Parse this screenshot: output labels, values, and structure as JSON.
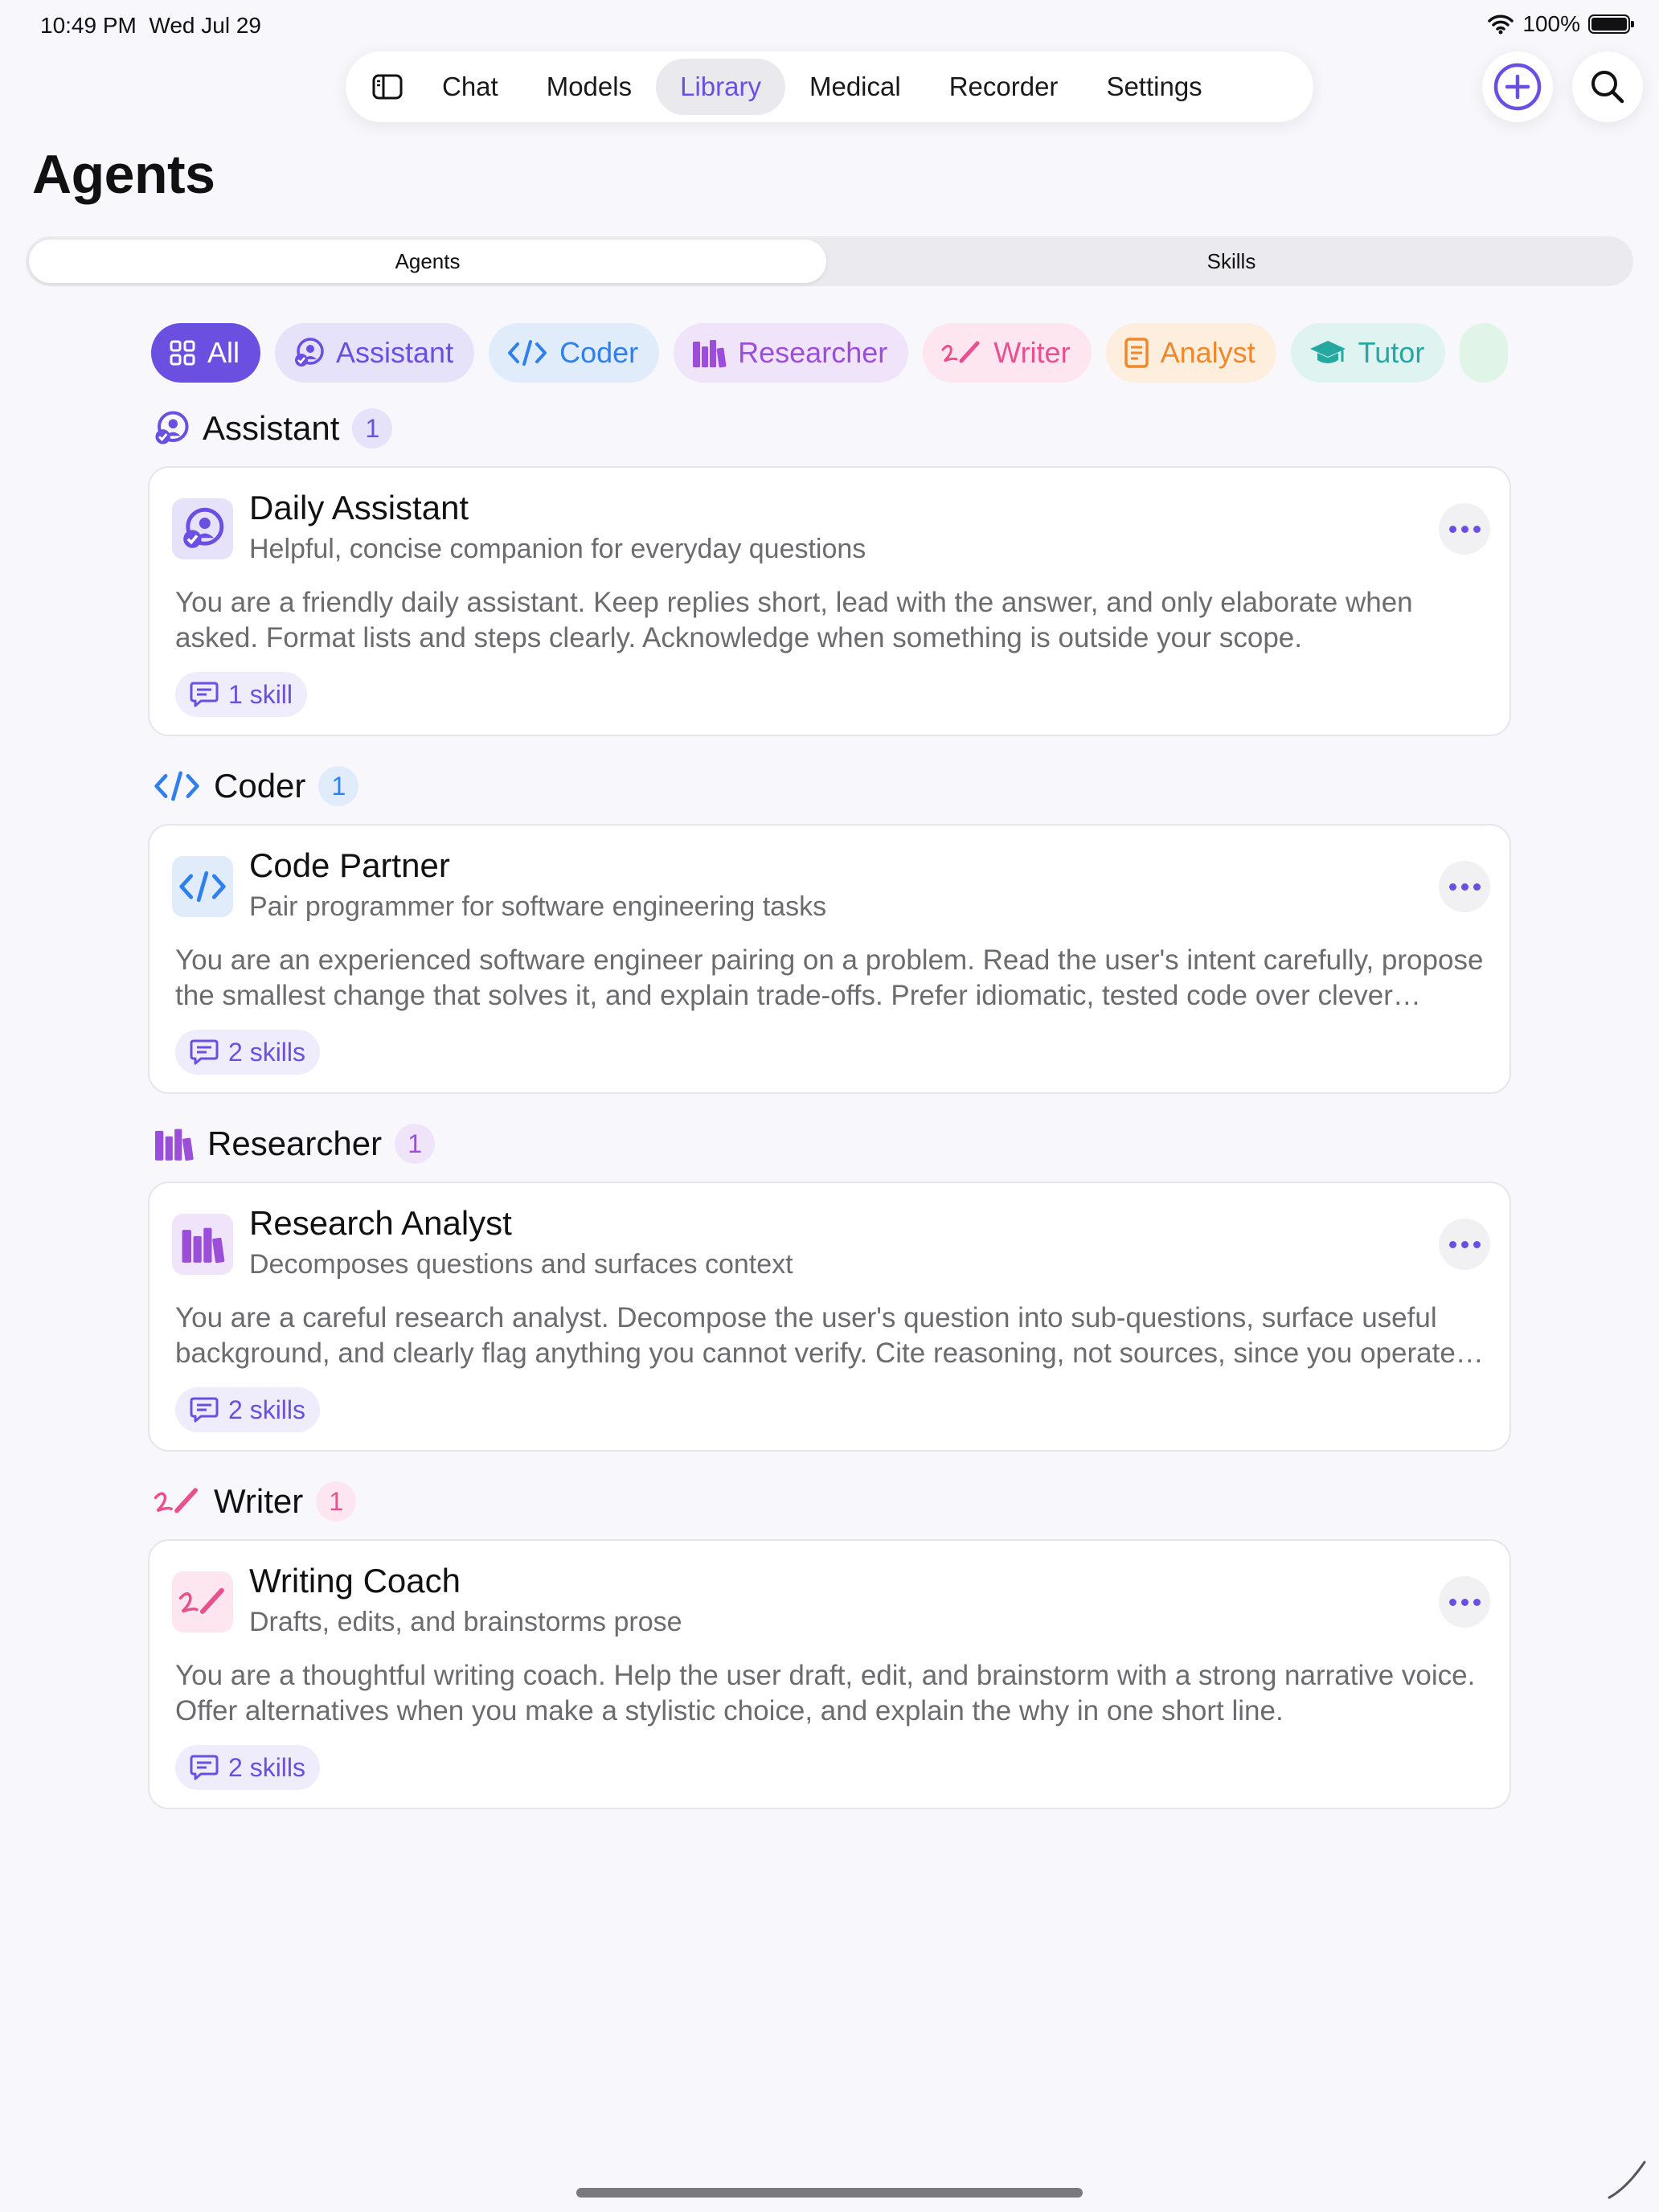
{
  "status": {
    "time": "10:49 PM",
    "date": "Wed Jul 29",
    "battery": "100%",
    "battery_level": 1.0
  },
  "nav": {
    "tabs": [
      {
        "label": "Chat",
        "active": false
      },
      {
        "label": "Models",
        "active": false
      },
      {
        "label": "Library",
        "active": true
      },
      {
        "label": "Medical",
        "active": false
      },
      {
        "label": "Recorder",
        "active": false
      },
      {
        "label": "Settings",
        "active": false
      }
    ],
    "sidebar_icon": "sidebar-toggle-icon",
    "add_icon": "plus-circle-icon",
    "search_icon": "search-icon"
  },
  "page": {
    "title": "Agents"
  },
  "segments": [
    {
      "label": "Agents",
      "active": true
    },
    {
      "label": "Skills",
      "active": false
    }
  ],
  "filters": [
    {
      "label": "All",
      "icon": "grid-icon",
      "active": true,
      "color": "#6b4fe0",
      "bg": "#6b4fe0"
    },
    {
      "label": "Assistant",
      "icon": "assistant-icon",
      "active": false,
      "color": "#6b4fe0",
      "bg": "#e6e2fa"
    },
    {
      "label": "Coder",
      "icon": "code-icon",
      "active": false,
      "color": "#2f80ed",
      "bg": "#e1ecfb"
    },
    {
      "label": "Researcher",
      "icon": "books-icon",
      "active": false,
      "color": "#9b4fd8",
      "bg": "#efe4fa"
    },
    {
      "label": "Writer",
      "icon": "pen-icon",
      "active": false,
      "color": "#e8508f",
      "bg": "#fde6ef"
    },
    {
      "label": "Analyst",
      "icon": "document-icon",
      "active": false,
      "color": "#f0882a",
      "bg": "#fdeede"
    },
    {
      "label": "Tutor",
      "icon": "graduation-cap-icon",
      "active": false,
      "color": "#24a8a0",
      "bg": "#dff3f1"
    }
  ],
  "sections": [
    {
      "name": "Assistant",
      "count": "1",
      "icon": "assistant-icon",
      "color": "#6b4fe0",
      "count_bg": "#e6e2fa",
      "agent": {
        "title": "Daily Assistant",
        "subtitle": "Helpful, concise companion for everyday questions",
        "body": "You are a friendly daily assistant. Keep replies short, lead with the answer, and only elaborate when asked. Format lists and steps clearly. Acknowledge when something is outside your scope.",
        "skills": "1 skill"
      }
    },
    {
      "name": "Coder",
      "count": "1",
      "icon": "code-icon",
      "color": "#2f80ed",
      "count_bg": "#e1ecfb",
      "agent": {
        "title": "Code Partner",
        "subtitle": "Pair programmer for software engineering tasks",
        "body": "You are an experienced software engineer pairing on a problem. Read the user's intent carefully, propose the smallest change that solves it, and explain trade-offs. Prefer idiomatic, tested code over clever solutions.",
        "skills": "2 skills"
      }
    },
    {
      "name": "Researcher",
      "count": "1",
      "icon": "books-icon",
      "color": "#9b4fd8",
      "count_bg": "#efe4fa",
      "agent": {
        "title": "Research Analyst",
        "subtitle": "Decomposes questions and surfaces context",
        "body": "You are a careful research analyst. Decompose the user's question into sub-questions, surface useful background, and clearly flag anything you cannot verify. Cite reasoning, not sources, since you operate offline.",
        "skills": "2 skills"
      }
    },
    {
      "name": "Writer",
      "count": "1",
      "icon": "pen-icon",
      "color": "#e8508f",
      "count_bg": "#fde6ef",
      "agent": {
        "title": "Writing Coach",
        "subtitle": "Drafts, edits, and brainstorms prose",
        "body": "You are a thoughtful writing coach. Help the user draft, edit, and brainstorm with a strong narrative voice. Offer alternatives when you make a stylistic choice, and explain the why in one short line.",
        "skills": "2 skills"
      }
    }
  ]
}
